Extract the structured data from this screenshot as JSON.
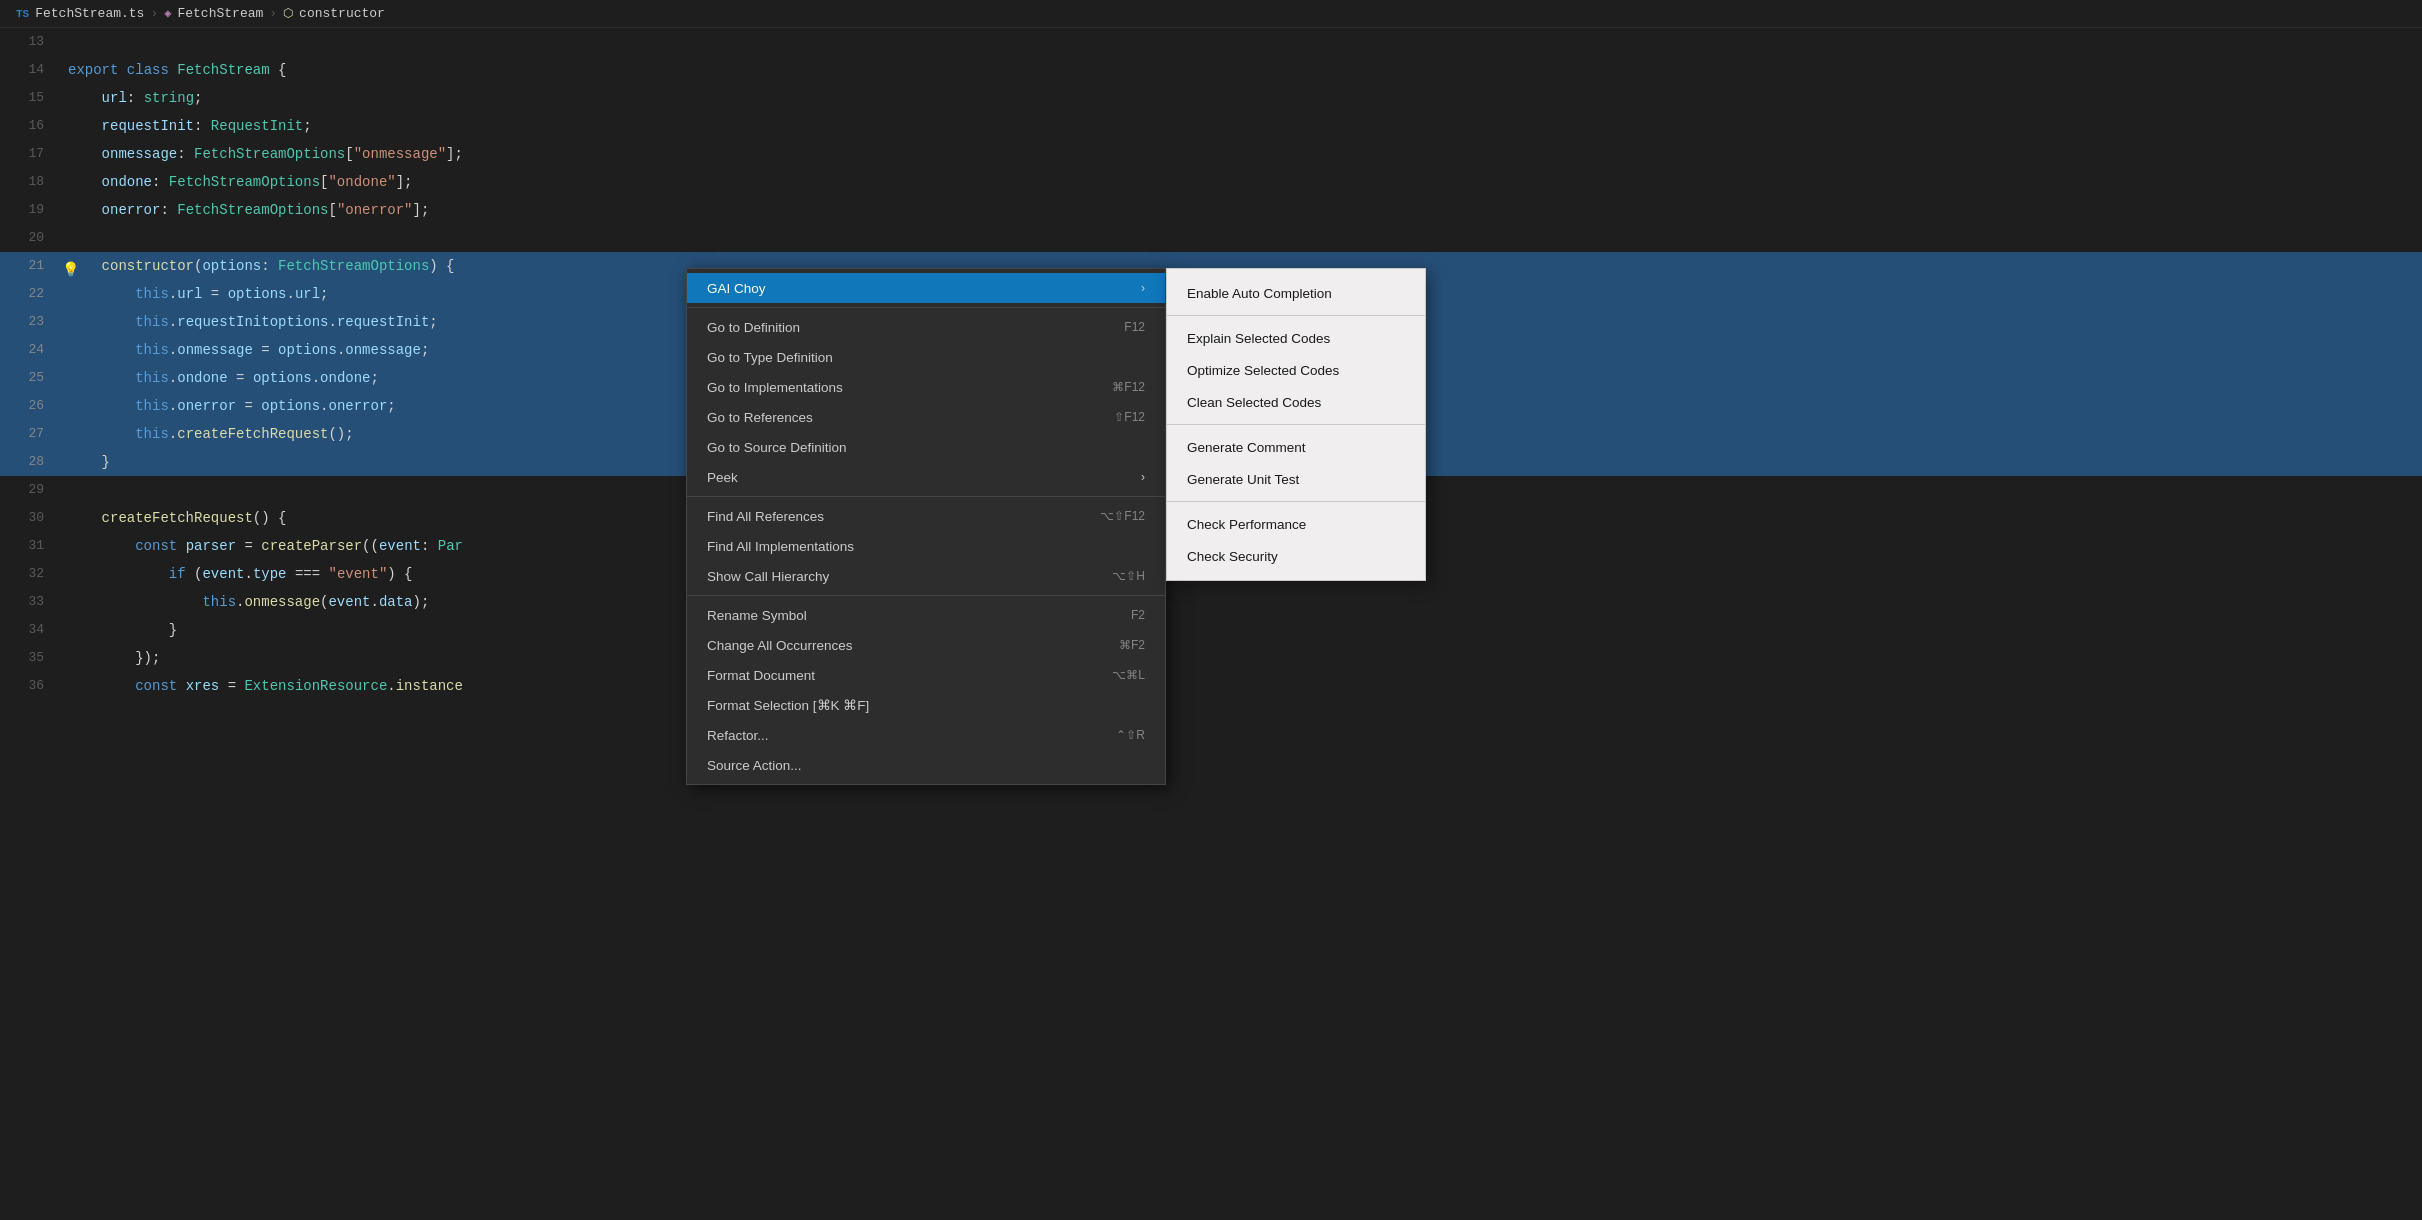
{
  "breadcrumb": {
    "ts_label": "TS",
    "file": "FetchStream.ts",
    "class": "FetchStream",
    "constructor": "constructor"
  },
  "code_lines": [
    {
      "num": "13",
      "tokens": []
    },
    {
      "num": "14",
      "tokens": [
        {
          "t": "kw",
          "v": "export"
        },
        {
          "t": "op",
          "v": " "
        },
        {
          "t": "kw",
          "v": "class"
        },
        {
          "t": "op",
          "v": " "
        },
        {
          "t": "cls",
          "v": "FetchStream"
        },
        {
          "t": "op",
          "v": " {"
        }
      ]
    },
    {
      "num": "15",
      "tokens": [
        {
          "t": "prop",
          "v": "    url"
        },
        {
          "t": "op",
          "v": ": "
        },
        {
          "t": "type",
          "v": "string"
        },
        {
          "t": "op",
          "v": ";"
        }
      ]
    },
    {
      "num": "16",
      "tokens": [
        {
          "t": "prop",
          "v": "    requestInit"
        },
        {
          "t": "op",
          "v": ": "
        },
        {
          "t": "type",
          "v": "RequestInit"
        },
        {
          "t": "op",
          "v": ";"
        }
      ]
    },
    {
      "num": "17",
      "tokens": [
        {
          "t": "prop",
          "v": "    onmessage"
        },
        {
          "t": "op",
          "v": ": "
        },
        {
          "t": "type",
          "v": "FetchStreamOptions"
        },
        {
          "t": "op",
          "v": "["
        },
        {
          "t": "str",
          "v": "\"onmessage\""
        },
        {
          "t": "op",
          "v": "];"
        }
      ]
    },
    {
      "num": "18",
      "tokens": [
        {
          "t": "prop",
          "v": "    ondone"
        },
        {
          "t": "op",
          "v": ": "
        },
        {
          "t": "type",
          "v": "FetchStreamOptions"
        },
        {
          "t": "op",
          "v": "["
        },
        {
          "t": "str",
          "v": "\"ondone\""
        },
        {
          "t": "op",
          "v": "];"
        }
      ]
    },
    {
      "num": "19",
      "tokens": [
        {
          "t": "prop",
          "v": "    onerror"
        },
        {
          "t": "op",
          "v": ": "
        },
        {
          "t": "type",
          "v": "FetchStreamOptions"
        },
        {
          "t": "op",
          "v": "["
        },
        {
          "t": "str",
          "v": "\"onerror\""
        },
        {
          "t": "op",
          "v": "];"
        }
      ]
    },
    {
      "num": "20",
      "tokens": []
    },
    {
      "num": "21",
      "tokens": [
        {
          "t": "fn",
          "v": "    constructor"
        },
        {
          "t": "op",
          "v": "("
        },
        {
          "t": "param",
          "v": "options"
        },
        {
          "t": "op",
          "v": ": "
        },
        {
          "t": "type",
          "v": "FetchStreamOptions"
        },
        {
          "t": "op",
          "v": ") {"
        }
      ],
      "selected": true,
      "hint": true
    },
    {
      "num": "22",
      "tokens": [
        {
          "t": "op",
          "v": "        "
        },
        {
          "t": "this-kw",
          "v": "this"
        },
        {
          "t": "op",
          "v": "."
        },
        {
          "t": "prop",
          "v": "url"
        },
        {
          "t": "op",
          "v": " = "
        },
        {
          "t": "param",
          "v": "options"
        },
        {
          "t": "op",
          "v": "."
        },
        {
          "t": "prop",
          "v": "url"
        },
        {
          "t": "op",
          "v": ";"
        }
      ],
      "selected": true
    },
    {
      "num": "23",
      "tokens": [
        {
          "t": "op",
          "v": "        "
        },
        {
          "t": "this-kw",
          "v": "this"
        },
        {
          "t": "op",
          "v": "."
        },
        {
          "t": "prop",
          "v": "requestInit"
        },
        {
          "t": "op",
          " = ": " = "
        },
        {
          "t": "param",
          "v": "options"
        },
        {
          "t": "op",
          "v": "."
        },
        {
          "t": "prop",
          "v": "requestInit"
        },
        {
          "t": "op",
          "v": ";"
        }
      ],
      "selected": true
    },
    {
      "num": "24",
      "tokens": [
        {
          "t": "op",
          "v": "        "
        },
        {
          "t": "this-kw",
          "v": "this"
        },
        {
          "t": "op",
          "v": "."
        },
        {
          "t": "prop",
          "v": "onmessage"
        },
        {
          "t": "op",
          "v": " = "
        },
        {
          "t": "param",
          "v": "options"
        },
        {
          "t": "op",
          "v": "."
        },
        {
          "t": "prop",
          "v": "onmessage"
        },
        {
          "t": "op",
          "v": ";"
        }
      ],
      "selected": true
    },
    {
      "num": "25",
      "tokens": [
        {
          "t": "op",
          "v": "        "
        },
        {
          "t": "this-kw",
          "v": "this"
        },
        {
          "t": "op",
          "v": "."
        },
        {
          "t": "prop",
          "v": "ondone"
        },
        {
          "t": "op",
          "v": " = "
        },
        {
          "t": "param",
          "v": "options"
        },
        {
          "t": "op",
          "v": "."
        },
        {
          "t": "prop",
          "v": "ondone"
        },
        {
          "t": "op",
          "v": ";"
        }
      ],
      "selected": true
    },
    {
      "num": "26",
      "tokens": [
        {
          "t": "op",
          "v": "        "
        },
        {
          "t": "this-kw",
          "v": "this"
        },
        {
          "t": "op",
          "v": "."
        },
        {
          "t": "prop",
          "v": "onerror"
        },
        {
          "t": "op",
          "v": " = "
        },
        {
          "t": "param",
          "v": "options"
        },
        {
          "t": "op",
          "v": "."
        },
        {
          "t": "prop",
          "v": "onerror"
        },
        {
          "t": "op",
          "v": ";"
        }
      ],
      "selected": true
    },
    {
      "num": "27",
      "tokens": [
        {
          "t": "op",
          "v": "        "
        },
        {
          "t": "this-kw",
          "v": "this"
        },
        {
          "t": "op",
          "v": "."
        },
        {
          "t": "method",
          "v": "createFetchRequest"
        },
        {
          "t": "op",
          "v": "();"
        }
      ],
      "selected": true
    },
    {
      "num": "28",
      "tokens": [
        {
          "t": "op",
          "v": "    }"
        }
      ],
      "selected": true
    },
    {
      "num": "29",
      "tokens": []
    },
    {
      "num": "30",
      "tokens": [
        {
          "t": "op",
          "v": "    "
        },
        {
          "t": "fn",
          "v": "createFetchRequest"
        },
        {
          "t": "op",
          "v": "() {"
        }
      ]
    },
    {
      "num": "31",
      "tokens": [
        {
          "t": "op",
          "v": "        "
        },
        {
          "t": "kw",
          "v": "const"
        },
        {
          "t": "op",
          "v": " "
        },
        {
          "t": "param",
          "v": "parser"
        },
        {
          "t": "op",
          "v": " = "
        },
        {
          "t": "fn",
          "v": "createParser"
        },
        {
          "t": "op",
          "v": "(("
        },
        {
          "t": "param",
          "v": "event"
        },
        {
          "t": "op",
          "v": ": "
        },
        {
          "t": "type",
          "v": "Par"
        }
      ]
    },
    {
      "num": "32",
      "tokens": [
        {
          "t": "op",
          "v": "            "
        },
        {
          "t": "kw",
          "v": "if"
        },
        {
          "t": "op",
          "v": " ("
        },
        {
          "t": "param",
          "v": "event"
        },
        {
          "t": "op",
          "v": "."
        },
        {
          "t": "prop",
          "v": "type"
        },
        {
          "t": "op",
          "v": " === "
        },
        {
          "t": "str",
          "v": "\"event\""
        },
        {
          "t": "op",
          "v": ") {"
        }
      ]
    },
    {
      "num": "33",
      "tokens": [
        {
          "t": "op",
          "v": "                "
        },
        {
          "t": "this-kw",
          "v": "this"
        },
        {
          "t": "op",
          "v": "."
        },
        {
          "t": "method",
          "v": "onmessage"
        },
        {
          "t": "op",
          "v": "("
        },
        {
          "t": "param",
          "v": "event"
        },
        {
          "t": "op",
          "v": "."
        },
        {
          "t": "prop",
          "v": "data"
        },
        {
          "t": "op",
          "v": ");"
        }
      ]
    },
    {
      "num": "34",
      "tokens": [
        {
          "t": "op",
          "v": "            }"
        }
      ]
    },
    {
      "num": "35",
      "tokens": [
        {
          "t": "op",
          "v": "        });"
        }
      ]
    },
    {
      "num": "36",
      "tokens": [
        {
          "t": "op",
          "v": "        "
        },
        {
          "t": "kw",
          "v": "const"
        },
        {
          "t": "op",
          "v": " "
        },
        {
          "t": "param",
          "v": "xres"
        },
        {
          "t": "op",
          "v": " = "
        },
        {
          "t": "type",
          "v": "ExtensionResource"
        },
        {
          "t": "op",
          "v": "."
        },
        {
          "t": "fn",
          "v": "instance"
        }
      ]
    }
  ],
  "context_menu": {
    "items": [
      {
        "id": "gai-choy",
        "label": "GAI Choy",
        "has_submenu": true
      },
      {
        "id": "separator1"
      },
      {
        "id": "go-to-definition",
        "label": "Go to Definition",
        "shortcut": "F12"
      },
      {
        "id": "go-to-type-definition",
        "label": "Go to Type Definition"
      },
      {
        "id": "go-to-implementations",
        "label": "Go to Implementations",
        "shortcut": "⌘F12"
      },
      {
        "id": "go-to-references",
        "label": "Go to References",
        "shortcut": "⇧F12"
      },
      {
        "id": "go-to-source-definition",
        "label": "Go to Source Definition"
      },
      {
        "id": "peek",
        "label": "Peek",
        "has_submenu": true
      },
      {
        "id": "separator2"
      },
      {
        "id": "find-all-references",
        "label": "Find All References",
        "shortcut": "⌥⇧F12"
      },
      {
        "id": "find-all-implementations",
        "label": "Find All Implementations"
      },
      {
        "id": "show-call-hierarchy",
        "label": "Show Call Hierarchy",
        "shortcut": "⌥⇧H"
      },
      {
        "id": "separator3"
      },
      {
        "id": "rename-symbol",
        "label": "Rename Symbol",
        "shortcut": "F2"
      },
      {
        "id": "change-all-occurrences",
        "label": "Change All Occurrences",
        "shortcut": "⌘F2"
      },
      {
        "id": "format-document",
        "label": "Format Document",
        "shortcut": "⌥⌘L"
      },
      {
        "id": "format-selection",
        "label": "Format Selection [⌘K ⌘F]"
      },
      {
        "id": "refactor",
        "label": "Refactor...",
        "shortcut": "⌃⇧R"
      },
      {
        "id": "source-action",
        "label": "Source Action..."
      }
    ]
  },
  "submenu": {
    "items": [
      {
        "id": "enable-auto-completion",
        "label": "Enable Auto Completion"
      },
      {
        "id": "separator1"
      },
      {
        "id": "explain-selected-codes",
        "label": "Explain Selected Codes"
      },
      {
        "id": "optimize-selected-codes",
        "label": "Optimize Selected Codes"
      },
      {
        "id": "clean-selected-codes",
        "label": "Clean Selected Codes"
      },
      {
        "id": "separator2"
      },
      {
        "id": "generate-comment",
        "label": "Generate Comment"
      },
      {
        "id": "generate-unit-test",
        "label": "Generate Unit Test"
      },
      {
        "id": "separator3"
      },
      {
        "id": "check-performance",
        "label": "Check Performance"
      },
      {
        "id": "check-security",
        "label": "Check Security"
      }
    ]
  }
}
